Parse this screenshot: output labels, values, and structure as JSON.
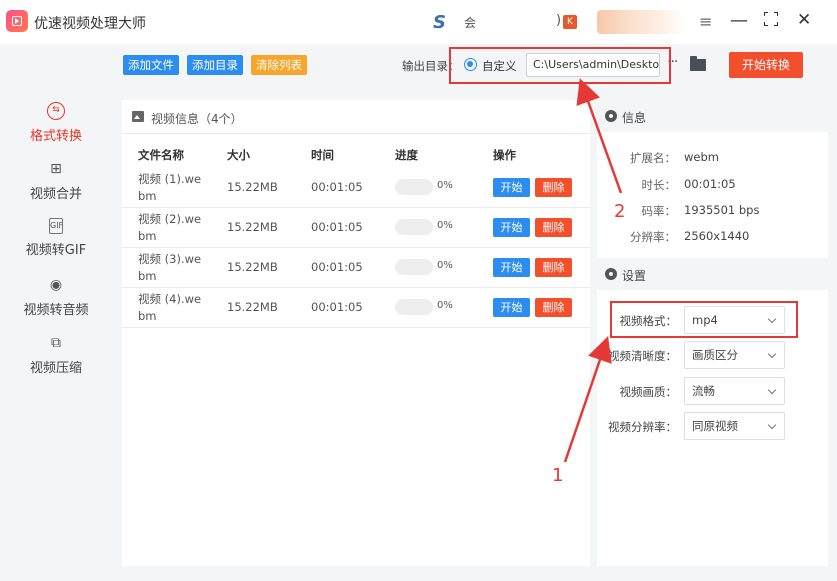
{
  "app": {
    "title": "优速视频处理大师"
  },
  "titlebar": {
    "s_logo": "S",
    "account_text": "会",
    "paren_text": ")",
    "k_badge": "K"
  },
  "sidebar": {
    "items": [
      {
        "label": "格式转换",
        "icon": "format-convert-icon"
      },
      {
        "label": "视频合并",
        "icon": "merge-icon"
      },
      {
        "label": "视频转GIF",
        "icon": "gif-icon"
      },
      {
        "label": "视频转音频",
        "icon": "audio-icon"
      },
      {
        "label": "视频压缩",
        "icon": "compress-icon"
      }
    ]
  },
  "toolbar": {
    "add_file": "添加文件",
    "add_dir": "添加目录",
    "clear_list": "清除列表",
    "output_label": "输出目录：",
    "radio_custom": "自定义",
    "output_path": "C:\\Users\\admin\\Deskto",
    "more": "···",
    "start_all": "开始转换"
  },
  "list": {
    "title": "视频信息（4个）",
    "columns": [
      "文件名称",
      "大小",
      "时间",
      "进度",
      "操作"
    ],
    "rows": [
      {
        "name": "视频 (1).webm",
        "size": "15.22MB",
        "time": "00:01:05",
        "progress": "0%",
        "start": "开始",
        "delete": "删除"
      },
      {
        "name": "视频 (2).webm",
        "size": "15.22MB",
        "time": "00:01:05",
        "progress": "0%",
        "start": "开始",
        "delete": "删除"
      },
      {
        "name": "视频 (3).webm",
        "size": "15.22MB",
        "time": "00:01:05",
        "progress": "0%",
        "start": "开始",
        "delete": "删除"
      },
      {
        "name": "视频 (4).webm",
        "size": "15.22MB",
        "time": "00:01:05",
        "progress": "0%",
        "start": "开始",
        "delete": "删除"
      }
    ]
  },
  "info": {
    "title": "信息",
    "fields": [
      {
        "k": "扩展名：",
        "v": "webm"
      },
      {
        "k": "时长：",
        "v": "00:01:05"
      },
      {
        "k": "码率：",
        "v": "1935501 bps"
      },
      {
        "k": "分辨率：",
        "v": "2560x1440"
      }
    ]
  },
  "settings": {
    "title": "设置",
    "fields": [
      {
        "k": "视频格式：",
        "v": "mp4"
      },
      {
        "k": "视频清晰度：",
        "v": "画质区分"
      },
      {
        "k": "视频画质：",
        "v": "流畅"
      },
      {
        "k": "视频分辨率：",
        "v": "同原视频"
      }
    ]
  },
  "annotations": {
    "n1": "1",
    "n2": "2"
  },
  "colors": {
    "accent_red": "#e8342a",
    "blue": "#2d8cf0",
    "orange": "#f7a52b",
    "annot_red": "#e53935"
  }
}
